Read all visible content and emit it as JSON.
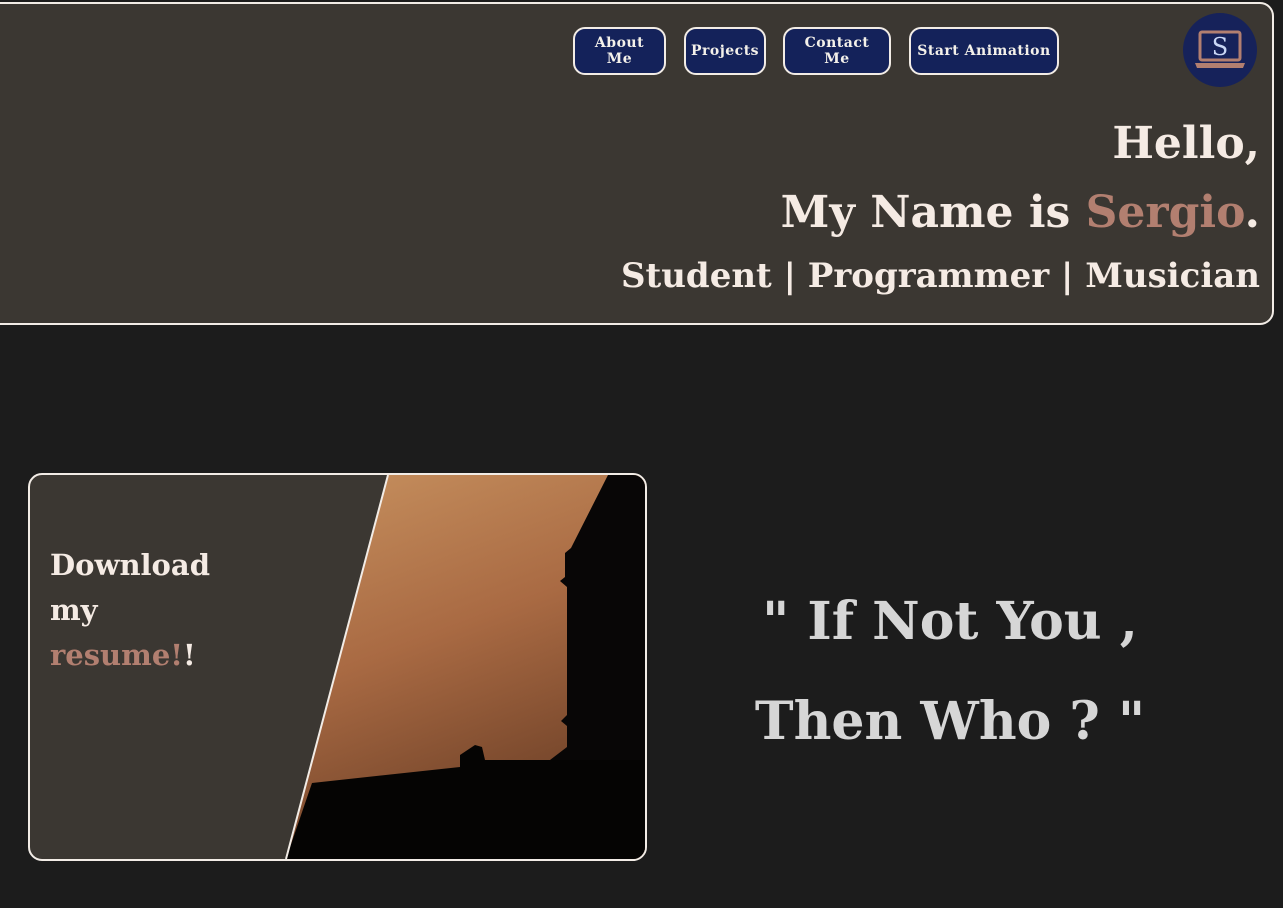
{
  "nav": {
    "about_label": "About Me",
    "projects_label": "Projects",
    "contact_label": "Contact Me",
    "animation_label": "Start Animation"
  },
  "logo": {
    "icon": "laptop-s-logo-icon",
    "letter": "S"
  },
  "hero": {
    "greeting": "Hello,",
    "name_prefix": "My Name is ",
    "name": "Sergio",
    "name_suffix": ".",
    "roles": "Student | Programmer | Musician"
  },
  "resume_card": {
    "line1": "Download",
    "line2": "my",
    "accent": "resume!",
    "suffix": "!",
    "image": "sunset-building-silhouette"
  },
  "quote": {
    "line1": "\" If Not You ,",
    "line2": "Then Who ? \""
  },
  "colors": {
    "page_bg": "#1c1c1c",
    "panel_bg": "#3b3732",
    "button_bg": "#14225a",
    "accent": "#b27f70",
    "text": "#f5ebe4",
    "quote_text": "#d6d6d6",
    "border": "#f2ece6"
  }
}
